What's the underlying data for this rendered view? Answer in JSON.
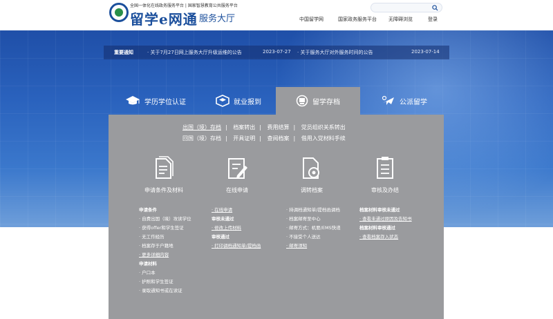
{
  "header": {
    "logo_top": "全国一体化在线政务服务平台 | 国家智慧教育公共服务平台",
    "logo_main": "留学e网通",
    "logo_sub": "服务大厅",
    "nav": [
      "中国留学网",
      "国家政务服务平台",
      "无障碍浏览",
      "登录"
    ],
    "search_icon": "search-icon"
  },
  "notice": {
    "label": "重要通知",
    "items": [
      {
        "text": "· 关于7月27日网上服务大厅升级运维的公告",
        "date": "2023-07-27"
      },
      {
        "text": "· 关于服务大厅对外服务时间的公告",
        "date": "2023-07-14"
      }
    ]
  },
  "tabs": [
    {
      "label": "学历学位认证",
      "icon": "graduation-cap-icon"
    },
    {
      "label": "就业报到",
      "icon": "briefcase-icon"
    },
    {
      "label": "留学存档",
      "icon": "folder-icon"
    },
    {
      "label": "公派留学",
      "icon": "airplane-icon"
    }
  ],
  "sublinks": {
    "row1": [
      "出国（境）存档",
      "档案转出",
      "费用结算",
      "党员组织关系转出"
    ],
    "row2": [
      "回国（境）存档",
      "开具证明",
      "查阅档案",
      "借用入党材料手续"
    ]
  },
  "functions": [
    {
      "label": "申请条件及材料",
      "icon": "document-icon"
    },
    {
      "label": "在线申请",
      "icon": "edit-form-icon"
    },
    {
      "label": "调转档案",
      "icon": "file-view-icon"
    },
    {
      "label": "审核及办结",
      "icon": "checklist-icon"
    }
  ],
  "columns": {
    "c1": {
      "h1": "申请条件",
      "items1": [
        "自费出国（境）攻读学位",
        "获得offer和学生签证",
        "无工作经历",
        "档案存于户籍地",
        "更多详细内容"
      ],
      "h2": "申请材料",
      "items2": [
        "户口本",
        "护照和学生签证",
        "录取通知书或在读证"
      ]
    },
    "c2": {
      "item0": "在线申请",
      "h1": "审核未通过",
      "item1": "修改上传材料",
      "h2": "审核通过",
      "item2": "打印调档通知单/提档函"
    },
    "c3": {
      "items": [
        "持调档通知单/提档函调档",
        "档案邮寄至中心",
        "邮寄方式：机要/EMS快递",
        "不接受个人送达",
        "邮寄须知"
      ]
    },
    "c4": {
      "h1": "档案材料审核未通过",
      "item1": "查看未通过原因及告知书",
      "h2": "档案材料审核通过",
      "item2": "查看档案存入状态"
    }
  },
  "colors": {
    "brand": "#1b4f9c",
    "banner": "#2a62bd",
    "panel": "#9a9b9e"
  }
}
